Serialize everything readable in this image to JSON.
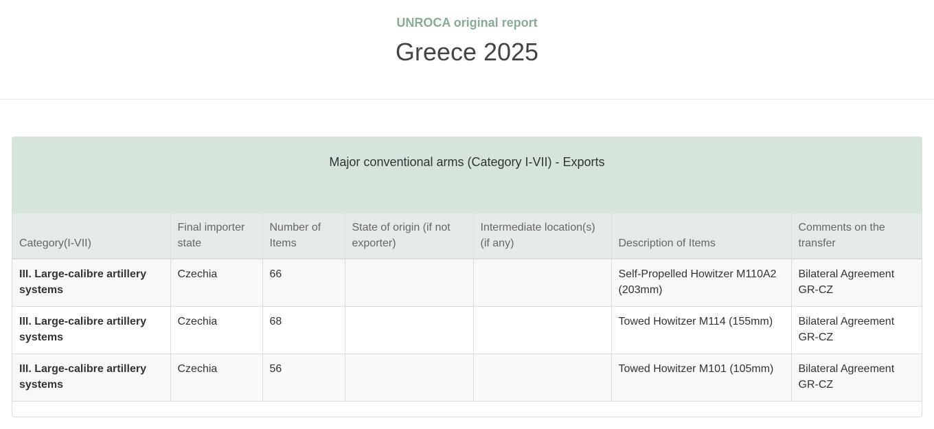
{
  "header": {
    "subtitle": "UNROCA original report",
    "title": "Greece 2025"
  },
  "panel": {
    "heading": "Major conventional arms (Category I-VII) - Exports"
  },
  "table": {
    "columns": [
      "Category(I-VII)",
      "Final importer state",
      "Number of Items",
      "State of origin (if not exporter)",
      "Intermediate location(s) (if any)",
      "Description of Items",
      "Comments on the transfer"
    ],
    "rows": [
      {
        "category": "III. Large-calibre artillery systems",
        "importer": "Czechia",
        "number": "66",
        "origin": "",
        "intermediate": "",
        "description": "Self-Propelled Howitzer M110A2 (203mm)",
        "comments": "Bilateral Agreement GR-CZ"
      },
      {
        "category": "III. Large-calibre artillery systems",
        "importer": "Czechia",
        "number": "68",
        "origin": "",
        "intermediate": "",
        "description": "Towed Howitzer M114 (155mm)",
        "comments": "Bilateral Agreement GR-CZ"
      },
      {
        "category": "III. Large-calibre artillery systems",
        "importer": "Czechia",
        "number": "56",
        "origin": "",
        "intermediate": "",
        "description": "Towed Howitzer M101 (105mm)",
        "comments": "Bilateral Agreement GR-CZ"
      }
    ]
  }
}
